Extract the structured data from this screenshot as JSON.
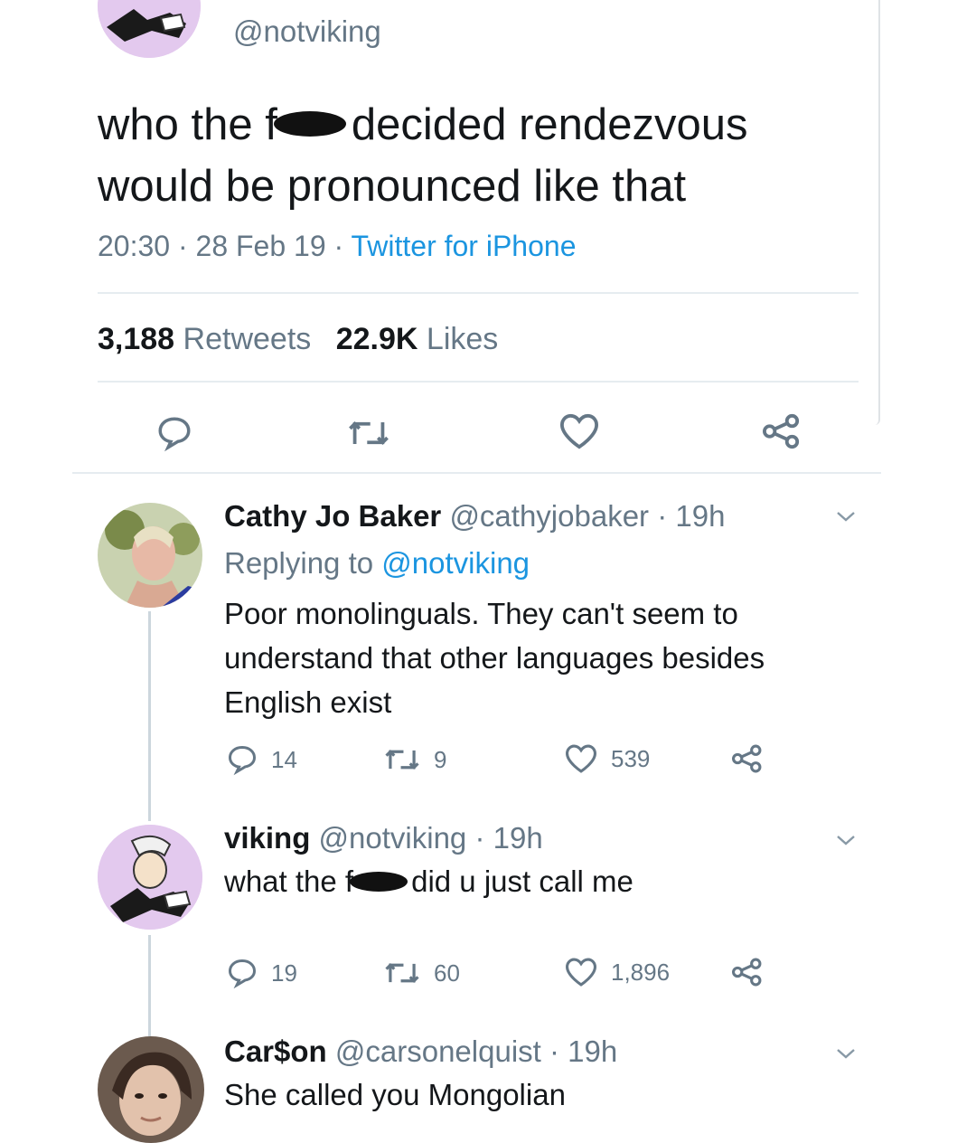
{
  "tweet": {
    "handle": "@notviking",
    "text_line1_a": "who the f",
    "text_line1_b": "decided rendezvous",
    "text_line2": "would be pronounced like that",
    "time": "20:30",
    "date": "28 Feb 19",
    "client": "Twitter for iPhone",
    "sep": "·",
    "retweets_count": "3,188",
    "retweets_label": "Retweets",
    "likes_count": "22.9K",
    "likes_label": "Likes"
  },
  "replies": [
    {
      "name": "Cathy Jo Baker",
      "handle": "@cathyjobaker",
      "age": "· 19h",
      "replying_prefix": "Replying to",
      "replying_to": "@notviking",
      "text_lines": [
        "Poor monolinguals. They can't seem to",
        "understand that other languages besides",
        "English exist"
      ],
      "replies": "14",
      "retweets": "9",
      "likes": "539"
    },
    {
      "name": "viking",
      "handle": "@notviking",
      "age": "· 19h",
      "text_a": "what the f",
      "text_b": "did u just call me",
      "replies": "19",
      "retweets": "60",
      "likes": "1,896"
    },
    {
      "name": "Car$on",
      "handle": "@carsonelquist",
      "age": "· 19h",
      "text": "She called you Mongolian"
    }
  ],
  "icons": [
    "reply-icon",
    "retweet-icon",
    "like-icon",
    "share-icon",
    "chevron-down-icon"
  ],
  "colors": {
    "link": "#1b95e0",
    "muted": "#657786",
    "text": "#14171a",
    "divider": "#e6ecf0"
  }
}
